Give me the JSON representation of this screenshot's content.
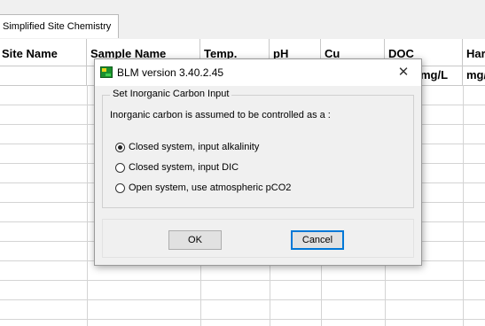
{
  "tab": {
    "label": "Simplified Site Chemistry"
  },
  "grid": {
    "columns": [
      {
        "label": "Site Name",
        "unit": ""
      },
      {
        "label": "Sample Name",
        "unit": ""
      },
      {
        "label": "Temp.",
        "unit": ""
      },
      {
        "label": "pH",
        "unit": ""
      },
      {
        "label": "Cu",
        "unit": ""
      },
      {
        "label": "DOC",
        "unit": "mg/L"
      },
      {
        "label": "Hardness",
        "unit": "mg/L"
      }
    ]
  },
  "dialog": {
    "title": "BLM version 3.40.2.45",
    "close_glyph": "✕",
    "group_title": "Set Inorganic Carbon Input",
    "description": "Inorganic carbon is assumed to be controlled as a :",
    "options": [
      {
        "label": "Closed system, input alkalinity",
        "checked": true
      },
      {
        "label": "Closed system, input DIC",
        "checked": false
      },
      {
        "label": "Open system, use atmospheric pCO2",
        "checked": false
      }
    ],
    "ok_label": "OK",
    "cancel_label": "Cancel"
  },
  "icons": {
    "app": "blm-app-icon",
    "close": "close-icon"
  },
  "colors": {
    "default_button_border": "#0078d7",
    "dialog_background": "#f0f0f0"
  }
}
